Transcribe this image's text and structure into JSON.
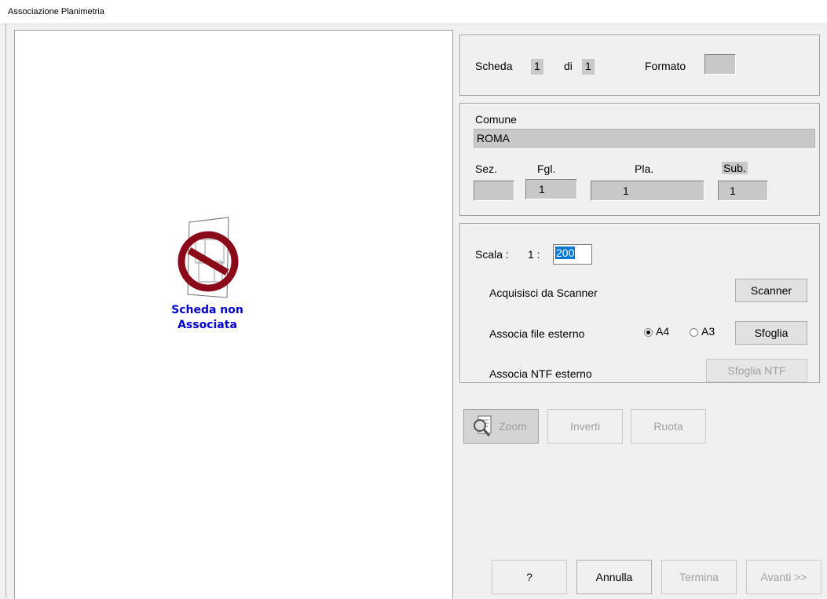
{
  "window": {
    "title": "Associazione Planimetria"
  },
  "preview": {
    "status_line1": "Scheda non",
    "status_line2": "Associata"
  },
  "header": {
    "scheda_label": "Scheda",
    "scheda_value": "1",
    "di_label": "di",
    "di_value": "1",
    "formato_label": "Formato",
    "formato_value": ""
  },
  "location": {
    "comune_label": "Comune",
    "comune_value": "ROMA",
    "sez_label": "Sez.",
    "sez_value": "",
    "fgl_label": "Fgl.",
    "fgl_value": "1",
    "pla_label": "Pla.",
    "pla_value": "1",
    "sub_label": "Sub.",
    "sub_value": "1"
  },
  "acquisition": {
    "scala_label": "Scala :",
    "scala_prefix": "1 :",
    "scala_value": "200",
    "scanner_label": "Acquisisci da Scanner",
    "scanner_button": "Scanner",
    "file_label": "Associa file esterno",
    "a4_label": "A4",
    "a3_label": "A3",
    "selected_format": "A4",
    "browse_button": "Sfoglia",
    "ntf_label": "Associa NTF esterno",
    "ntf_button": "Sfoglia NTF"
  },
  "tools": {
    "zoom": "Zoom",
    "invert": "Inverti",
    "rotate": "Ruota"
  },
  "footer": {
    "help": "?",
    "cancel": "Annulla",
    "finish": "Termina",
    "next": "Avanti >>"
  }
}
